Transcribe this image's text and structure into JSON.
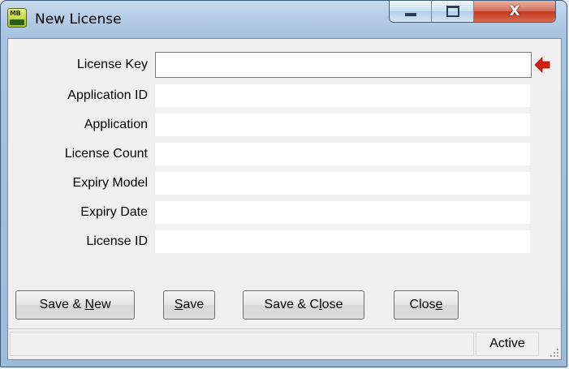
{
  "window": {
    "title": "New License",
    "icon": "mb-app-icon",
    "controls": {
      "minimize": "minimize-icon",
      "maximize": "maximize-icon",
      "close": "X"
    }
  },
  "form": {
    "fields": [
      {
        "label": "License Key",
        "value": "",
        "editable": true
      },
      {
        "label": "Application ID",
        "value": ""
      },
      {
        "label": "Application",
        "value": ""
      },
      {
        "label": "License Count",
        "value": ""
      },
      {
        "label": "Expiry Model",
        "value": ""
      },
      {
        "label": "Expiry Date",
        "value": ""
      },
      {
        "label": "License ID",
        "value": ""
      }
    ],
    "required_indicator_icon": "red-left-arrow-icon",
    "required_indicator_color": "#d61f0a"
  },
  "buttons": {
    "save_new": {
      "pre": "Save & ",
      "mnemonic": "N",
      "post": "ew"
    },
    "save": {
      "pre": "",
      "mnemonic": "S",
      "post": "ave"
    },
    "save_close": {
      "pre": "Save & C",
      "mnemonic": "l",
      "post": "ose"
    },
    "close": {
      "pre": "Clos",
      "mnemonic": "e",
      "post": ""
    }
  },
  "statusbar": {
    "message": "",
    "state": "Active"
  }
}
